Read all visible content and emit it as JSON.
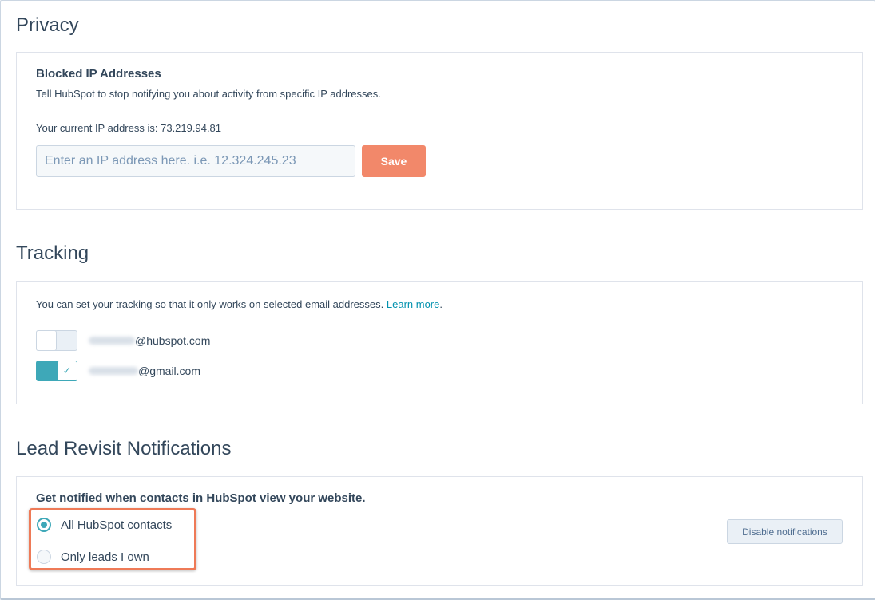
{
  "privacy": {
    "title": "Privacy",
    "blocked_heading": "Blocked IP Addresses",
    "description": "Tell HubSpot to stop notifying you about activity from specific IP addresses.",
    "current_ip_label": "Your current IP address is:",
    "current_ip_value": "73.219.94.81",
    "ip_input_placeholder": "Enter an IP address here. i.e. 12.324.245.23",
    "ip_input_value": "",
    "save_label": "Save",
    "save_color": "#f2886a"
  },
  "tracking": {
    "title": "Tracking",
    "description": "You can set your tracking so that it only works on selected email addresses.",
    "learn_more": "Learn more",
    "period": ".",
    "emails": [
      {
        "domain": "@hubspot.com",
        "enabled": false
      },
      {
        "domain": "@gmail.com",
        "enabled": true
      }
    ],
    "accent_color": "#3ea8b8"
  },
  "lead_revisit": {
    "title": "Lead Revisit Notifications",
    "heading": "Get notified when contacts in HubSpot view your website.",
    "options": [
      {
        "label": "All HubSpot contacts",
        "selected": true
      },
      {
        "label": "Only leads I own",
        "selected": false
      }
    ],
    "disable_label": "Disable notifications",
    "highlight_color": "#ee7a57"
  }
}
